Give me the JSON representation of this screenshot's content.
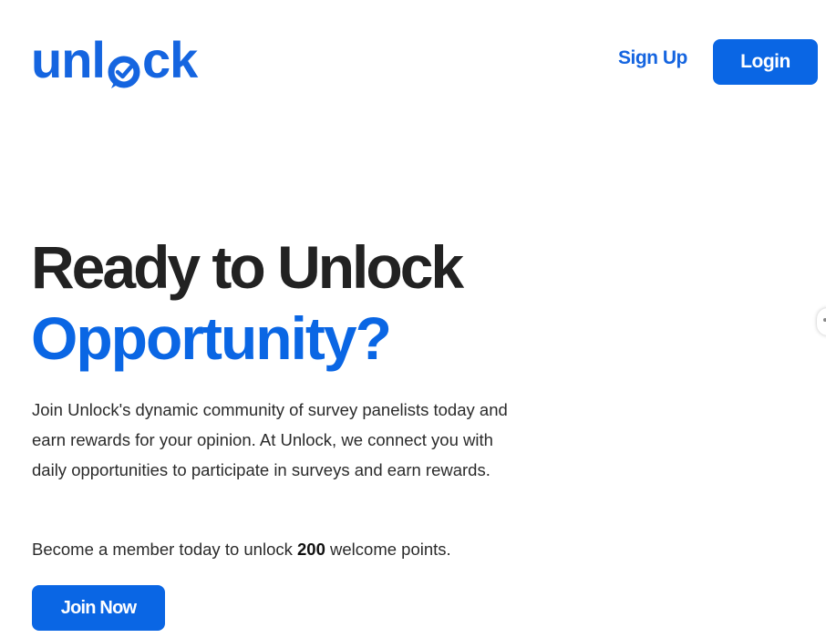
{
  "header": {
    "logo": {
      "before": "unl",
      "after": "ck",
      "icon": "speech-bubble-check-icon"
    },
    "signup_label": "Sign Up",
    "login_label": "Login"
  },
  "hero": {
    "title_line1": "Ready to Unlock",
    "title_line2": "Opportunity?",
    "description": "Join Unlock's dynamic community of survey panelists today and earn rewards for your opinion. At Unlock, we connect you with daily opportunities to participate in surveys and earn rewards.",
    "member_text_before": "Become a member today to unlock ",
    "member_points": "200",
    "member_text_after": " welcome points.",
    "cta_label": "Join Now"
  },
  "colors": {
    "brand_blue": "#0a66e4",
    "text_dark": "#222222"
  }
}
